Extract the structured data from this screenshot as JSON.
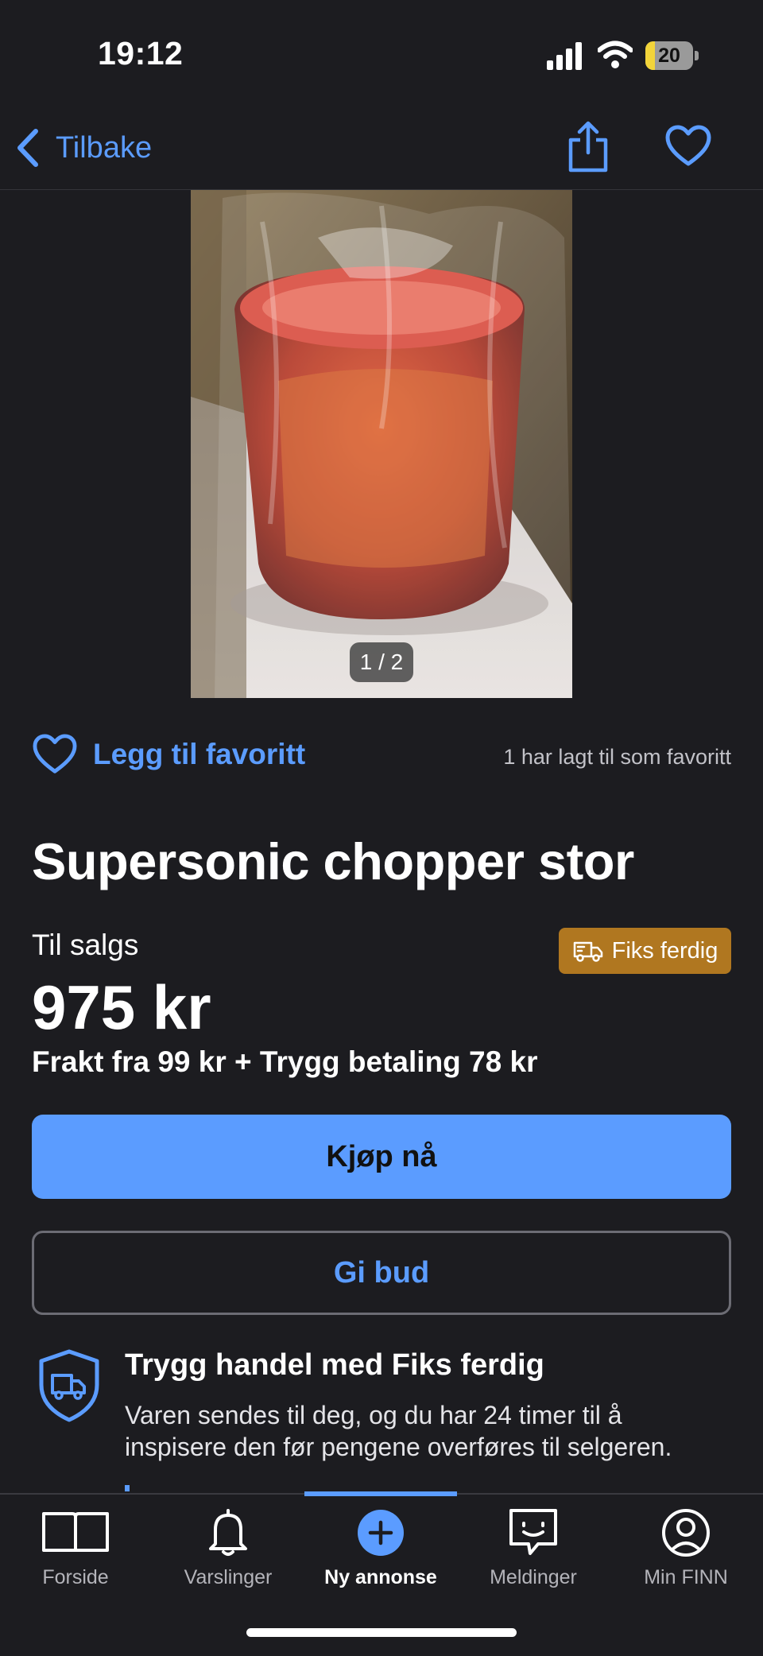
{
  "status_bar": {
    "time": "19:12",
    "battery_level": "20",
    "battery_fraction": 0.2,
    "icons": [
      "cellular-signal-icon",
      "wifi-icon",
      "battery-icon"
    ]
  },
  "nav": {
    "back_label": "Tilbake",
    "icons": [
      "chevron-left-icon",
      "share-icon",
      "heart-icon"
    ]
  },
  "gallery": {
    "counter": "1 / 2",
    "current": 1,
    "total": 2
  },
  "favorite": {
    "label": "Legg til favoritt",
    "count_text": "1 har lagt til som favoritt"
  },
  "listing": {
    "title": "Supersonic chopper stor",
    "status": "Til salgs",
    "badge": "Fiks ferdig",
    "price": "975 kr",
    "shipping": "Frakt fra 99 kr + Trygg betaling 78 kr"
  },
  "actions": {
    "buy": "Kjøp nå",
    "bid": "Gi bud"
  },
  "safe_trade": {
    "title": "Trygg handel med Fiks ferdig",
    "text": "Varen sendes til deg, og du har 24 timer til å inspisere den før pengene overføres til selgeren."
  },
  "tabbar": {
    "tabs": [
      {
        "label": "Forside",
        "icon": "book-icon"
      },
      {
        "label": "Varslinger",
        "icon": "bell-icon"
      },
      {
        "label": "Ny annonse",
        "icon": "plus-circle-icon",
        "active": true
      },
      {
        "label": "Meldinger",
        "icon": "chat-icon"
      },
      {
        "label": "Min FINN",
        "icon": "profile-icon"
      }
    ]
  },
  "colors": {
    "background": "#1c1c20",
    "accent": "#5b9cff",
    "badge": "#b07720",
    "text": "#ffffff",
    "muted": "#c2c2c8"
  }
}
